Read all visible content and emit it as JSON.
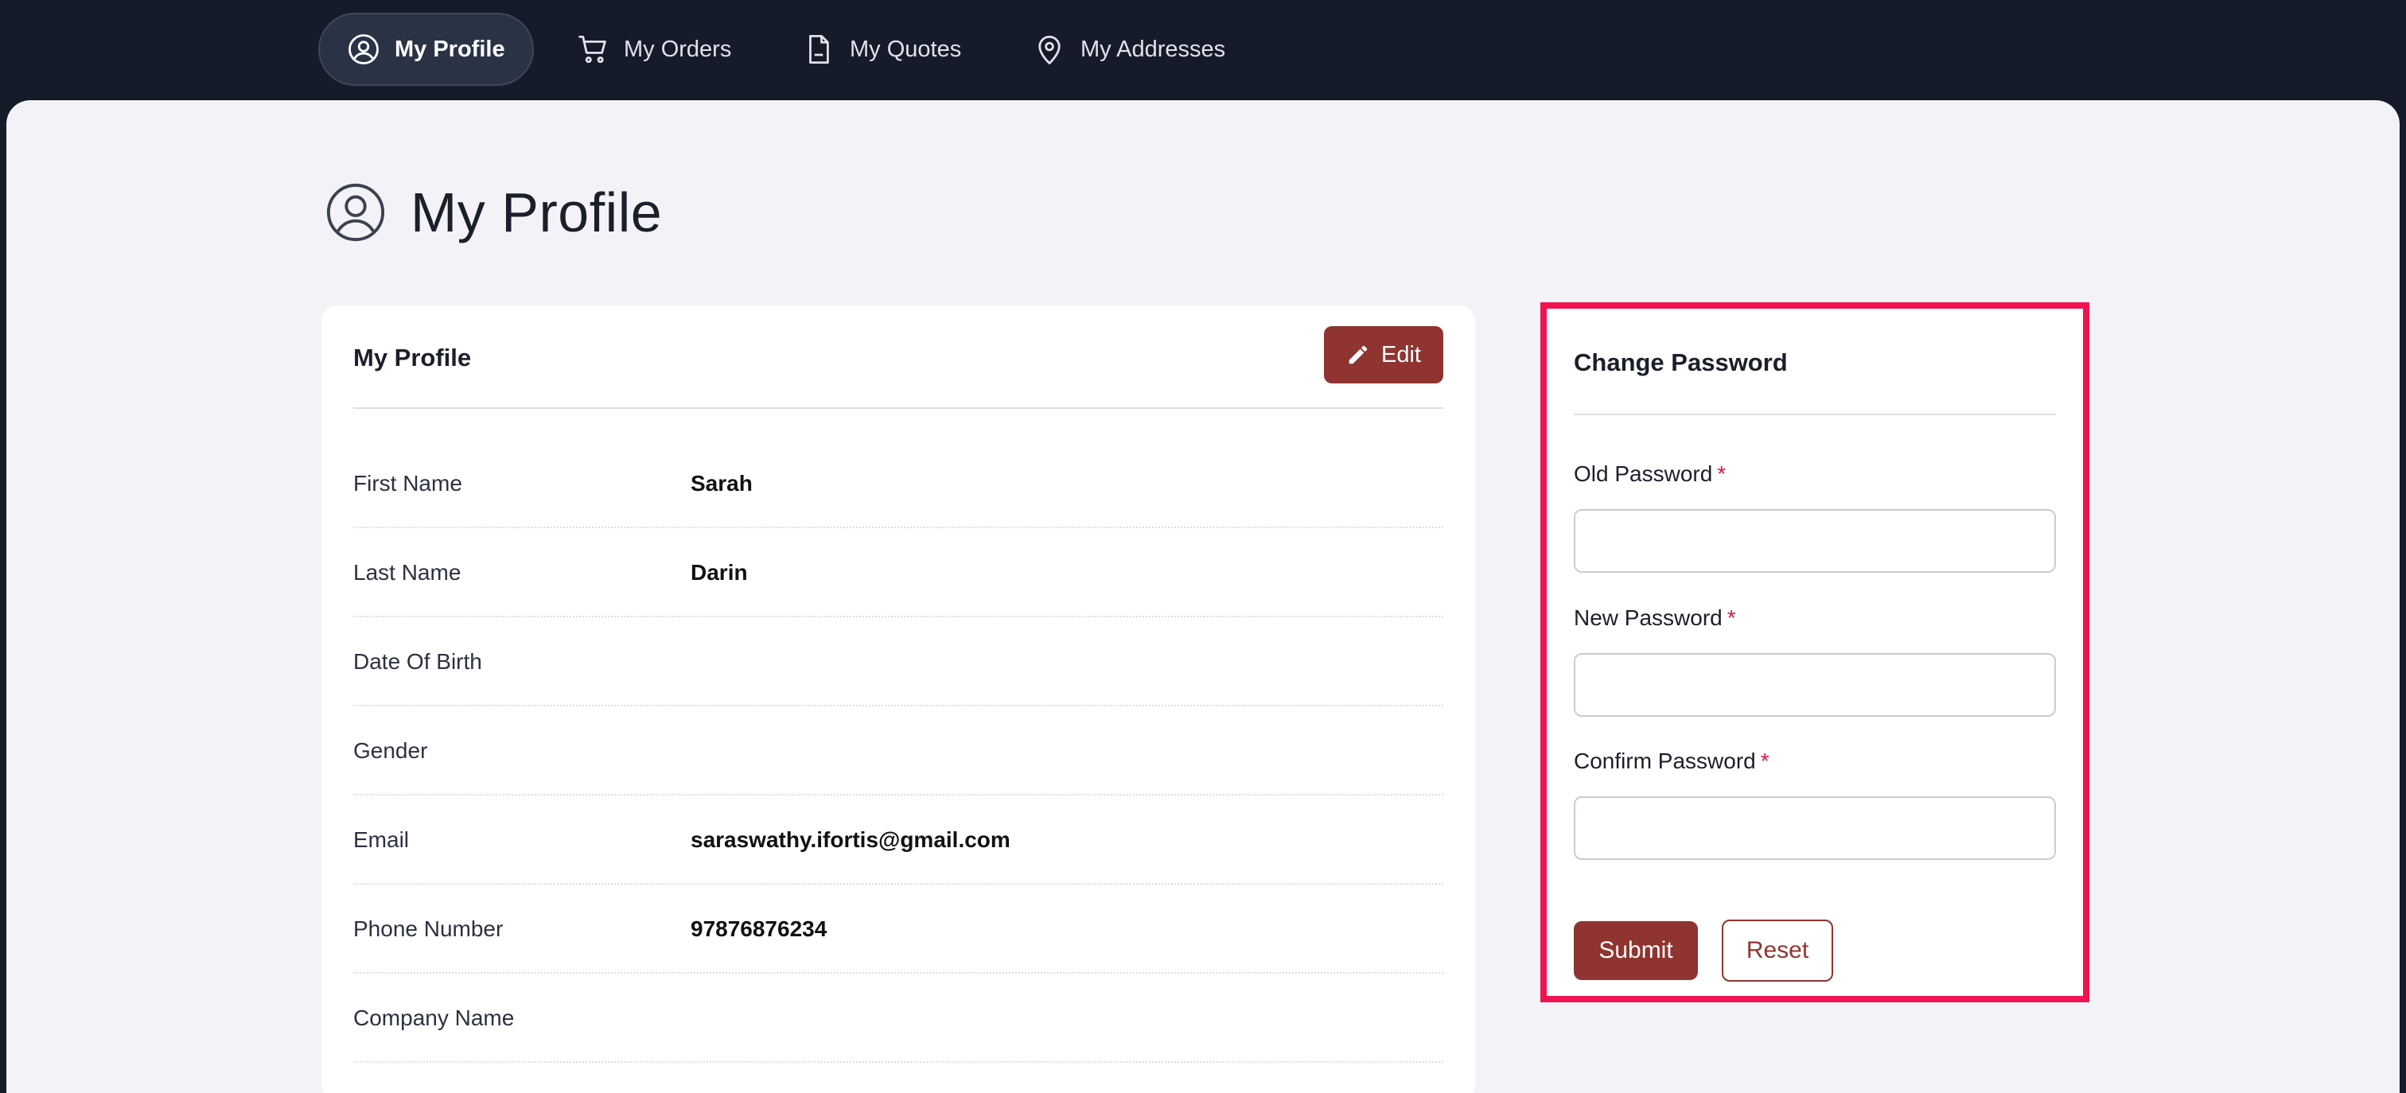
{
  "nav": {
    "items": [
      {
        "label": "My Profile",
        "icon": "user-circle-icon"
      },
      {
        "label": "My Orders",
        "icon": "cart-icon"
      },
      {
        "label": "My Quotes",
        "icon": "document-icon"
      },
      {
        "label": "My Addresses",
        "icon": "location-pin-icon"
      }
    ],
    "active": "My Profile"
  },
  "page": {
    "title": "My Profile",
    "title_icon": "user-circle-icon"
  },
  "profile": {
    "card_title": "My Profile",
    "edit_label": "Edit",
    "fields": [
      {
        "label": "First Name",
        "value": "Sarah"
      },
      {
        "label": "Last Name",
        "value": "Darin"
      },
      {
        "label": "Date Of Birth",
        "value": ""
      },
      {
        "label": "Gender",
        "value": ""
      },
      {
        "label": "Email",
        "value": "saraswathy.ifortis@gmail.com"
      },
      {
        "label": "Phone Number",
        "value": "97876876234"
      },
      {
        "label": "Company Name",
        "value": ""
      }
    ]
  },
  "password": {
    "card_title": "Change Password",
    "fields": [
      {
        "label": "Old Password",
        "required_mark": "*",
        "value": ""
      },
      {
        "label": "New Password",
        "required_mark": "*",
        "value": ""
      },
      {
        "label": "Confirm Password",
        "required_mark": "*",
        "value": ""
      }
    ],
    "submit_label": "Submit",
    "reset_label": "Reset"
  },
  "colors": {
    "nav_bg": "#151b29",
    "accent": "#8f3430",
    "highlight_border": "#f0134f",
    "required": "#e0144f",
    "page_bg": "#f3f3f7"
  }
}
